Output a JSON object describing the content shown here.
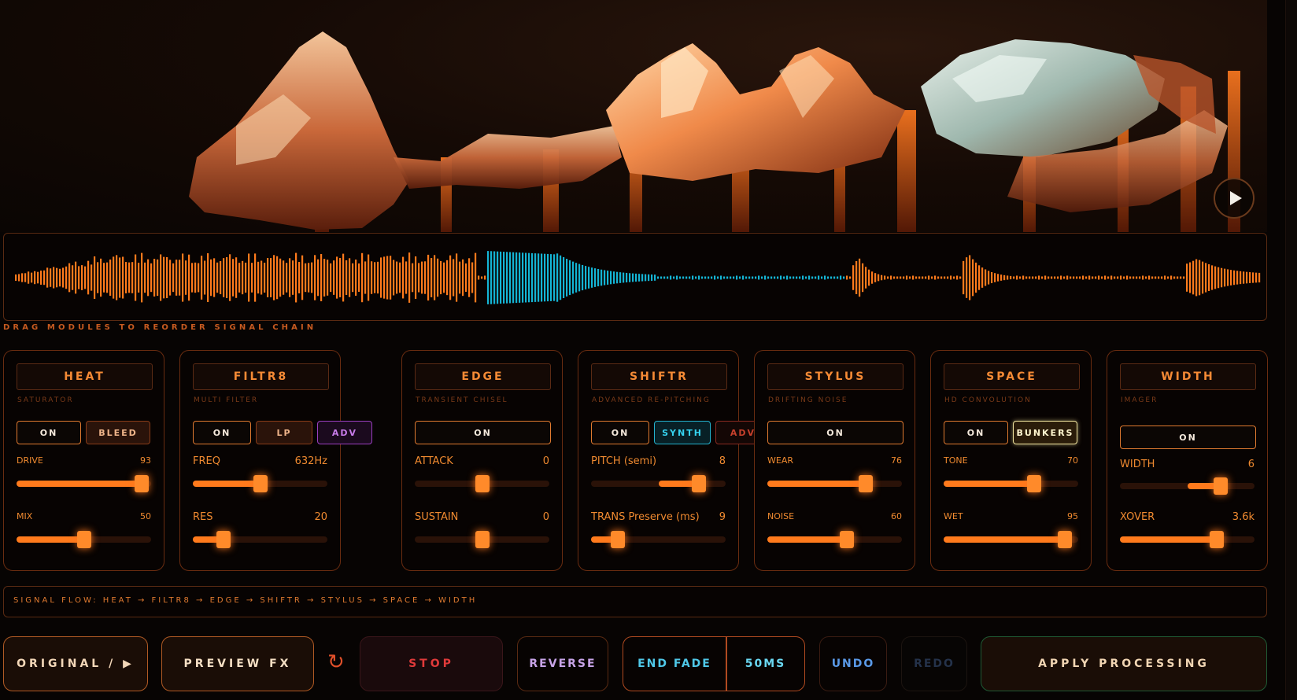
{
  "hero": {
    "play_icon": "play-icon"
  },
  "waveform": {
    "selection_color": "#14b4d4",
    "base_color": "#ff7a1c"
  },
  "hint": "DRAG MODULES TO REORDER SIGNAL CHAIN",
  "modules": [
    {
      "title": "HEAT",
      "subtitle": "SATURATOR",
      "buttons": [
        "ON",
        "BLEED"
      ],
      "params": [
        {
          "label": "DRIVE",
          "value": "93",
          "level": 0.93
        },
        {
          "label": "MIX",
          "value": "50",
          "level": 0.5
        }
      ]
    },
    {
      "title": "FILTR8",
      "subtitle": "MULTI FILTER",
      "buttons": [
        "ON",
        "LP",
        "ADV"
      ],
      "params": [
        {
          "label": "FREQ",
          "value": "632Hz",
          "level": 0.5
        },
        {
          "label": "RES",
          "value": "20",
          "level": 0.23
        }
      ]
    },
    {
      "title": "EDGE",
      "subtitle": "TRANSIENT CHISEL",
      "buttons": [
        "ON"
      ],
      "params": [
        {
          "label": "ATTACK",
          "value": "0",
          "level": 0.5
        },
        {
          "label": "SUSTAIN",
          "value": "0",
          "level": 0.5
        }
      ]
    },
    {
      "title": "SHIFTR",
      "subtitle": "ADVANCED RE-PITCHING",
      "buttons": [
        "ON",
        "SYNTH",
        "ADV"
      ],
      "params": [
        {
          "label": "PITCH (semi)",
          "value": "8",
          "level": 0.8
        },
        {
          "label": "TRANS Preserve (ms)",
          "value": "9",
          "level": 0.2
        }
      ]
    },
    {
      "title": "STYLUS",
      "subtitle": "DRIFTING NOISE",
      "buttons": [
        "ON"
      ],
      "params": [
        {
          "label": "WEAR",
          "value": "76",
          "level": 0.73
        },
        {
          "label": "NOISE",
          "value": "60",
          "level": 0.59
        }
      ]
    },
    {
      "title": "SPACE",
      "subtitle": "HD CONVOLUTION",
      "buttons": [
        "ON",
        "BUNKERS"
      ],
      "params": [
        {
          "label": "TONE",
          "value": "70",
          "level": 0.67
        },
        {
          "label": "WET",
          "value": "95",
          "level": 0.9
        }
      ]
    },
    {
      "title": "WIDTH",
      "subtitle": "IMAGER",
      "buttons": [
        "ON"
      ],
      "params": [
        {
          "label": "WIDTH",
          "value": "6",
          "level": 0.75
        },
        {
          "label": "XOVER",
          "value": "3.6k",
          "level": 0.72
        }
      ]
    }
  ],
  "flow": "SIGNAL FLOW: HEAT → FILTR8 → EDGE → SHIFTR → STYLUS → SPACE → WIDTH",
  "actions": {
    "original": "ORIGINAL / ▶",
    "preview": "PREVIEW FX",
    "reload_icon": "↻",
    "stop": "STOP",
    "reverse": "REVERSE",
    "end_fade": "END FADE",
    "fade_value": "50MS",
    "undo": "UNDO",
    "redo": "REDO",
    "apply": "APPLY PROCESSING"
  }
}
